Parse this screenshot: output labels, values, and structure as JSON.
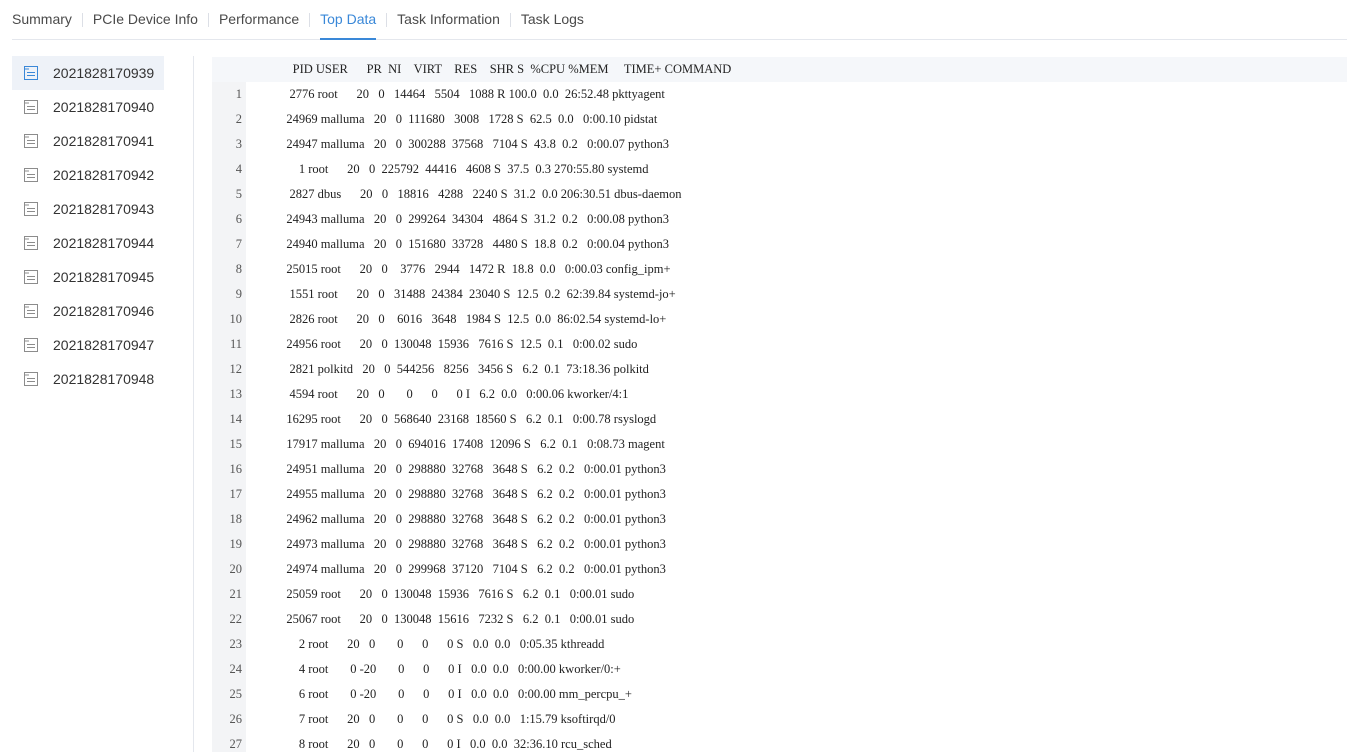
{
  "tabs": [
    {
      "label": "Summary",
      "active": false
    },
    {
      "label": "PCIe Device Info",
      "active": false
    },
    {
      "label": "Performance",
      "active": false
    },
    {
      "label": "Top Data",
      "active": true
    },
    {
      "label": "Task Information",
      "active": false
    },
    {
      "label": "Task Logs",
      "active": false
    }
  ],
  "sidebar": {
    "items": [
      {
        "label": "2021828170939",
        "active": true
      },
      {
        "label": "2021828170940",
        "active": false
      },
      {
        "label": "2021828170941",
        "active": false
      },
      {
        "label": "2021828170942",
        "active": false
      },
      {
        "label": "2021828170943",
        "active": false
      },
      {
        "label": "2021828170944",
        "active": false
      },
      {
        "label": "2021828170945",
        "active": false
      },
      {
        "label": "2021828170946",
        "active": false
      },
      {
        "label": "2021828170947",
        "active": false
      },
      {
        "label": "2021828170948",
        "active": false
      }
    ],
    "icon": "document-icon"
  },
  "top": {
    "header": "     PID USER      PR  NI    VIRT    RES    SHR S  %CPU %MEM     TIME+ COMMAND",
    "rows": [
      {
        "n": "1",
        "text": "    2776 root      20   0   14464   5504   1088 R 100.0  0.0  26:52.48 pkttyagent"
      },
      {
        "n": "2",
        "text": "   24969 malluma   20   0  111680   3008   1728 S  62.5  0.0   0:00.10 pidstat"
      },
      {
        "n": "3",
        "text": "   24947 malluma   20   0  300288  37568   7104 S  43.8  0.2   0:00.07 python3"
      },
      {
        "n": "4",
        "text": "       1 root      20   0  225792  44416   4608 S  37.5  0.3 270:55.80 systemd"
      },
      {
        "n": "5",
        "text": "    2827 dbus      20   0   18816   4288   2240 S  31.2  0.0 206:30.51 dbus-daemon"
      },
      {
        "n": "6",
        "text": "   24943 malluma   20   0  299264  34304   4864 S  31.2  0.2   0:00.08 python3"
      },
      {
        "n": "7",
        "text": "   24940 malluma   20   0  151680  33728   4480 S  18.8  0.2   0:00.04 python3"
      },
      {
        "n": "8",
        "text": "   25015 root      20   0    3776   2944   1472 R  18.8  0.0   0:00.03 config_ipm+"
      },
      {
        "n": "9",
        "text": "    1551 root      20   0   31488  24384  23040 S  12.5  0.2  62:39.84 systemd-jo+"
      },
      {
        "n": "10",
        "text": "    2826 root      20   0    6016   3648   1984 S  12.5  0.0  86:02.54 systemd-lo+"
      },
      {
        "n": "11",
        "text": "   24956 root      20   0  130048  15936   7616 S  12.5  0.1   0:00.02 sudo"
      },
      {
        "n": "12",
        "text": "    2821 polkitd   20   0  544256   8256   3456 S   6.2  0.1  73:18.36 polkitd"
      },
      {
        "n": "13",
        "text": "    4594 root      20   0       0      0      0 I   6.2  0.0   0:00.06 kworker/4:1"
      },
      {
        "n": "14",
        "text": "   16295 root      20   0  568640  23168  18560 S   6.2  0.1   0:00.78 rsyslogd"
      },
      {
        "n": "15",
        "text": "   17917 malluma   20   0  694016  17408  12096 S   6.2  0.1   0:08.73 magent"
      },
      {
        "n": "16",
        "text": "   24951 malluma   20   0  298880  32768   3648 S   6.2  0.2   0:00.01 python3"
      },
      {
        "n": "17",
        "text": "   24955 malluma   20   0  298880  32768   3648 S   6.2  0.2   0:00.01 python3"
      },
      {
        "n": "18",
        "text": "   24962 malluma   20   0  298880  32768   3648 S   6.2  0.2   0:00.01 python3"
      },
      {
        "n": "19",
        "text": "   24973 malluma   20   0  298880  32768   3648 S   6.2  0.2   0:00.01 python3"
      },
      {
        "n": "20",
        "text": "   24974 malluma   20   0  299968  37120   7104 S   6.2  0.2   0:00.01 python3"
      },
      {
        "n": "21",
        "text": "   25059 root      20   0  130048  15936   7616 S   6.2  0.1   0:00.01 sudo"
      },
      {
        "n": "22",
        "text": "   25067 root      20   0  130048  15616   7232 S   6.2  0.1   0:00.01 sudo"
      },
      {
        "n": "23",
        "text": "       2 root      20   0       0      0      0 S   0.0  0.0   0:05.35 kthreadd"
      },
      {
        "n": "24",
        "text": "       4 root       0 -20       0      0      0 I   0.0  0.0   0:00.00 kworker/0:+"
      },
      {
        "n": "25",
        "text": "       6 root       0 -20       0      0      0 I   0.0  0.0   0:00.00 mm_percpu_+"
      },
      {
        "n": "26",
        "text": "       7 root      20   0       0      0      0 S   0.0  0.0   1:15.79 ksoftirqd/0"
      },
      {
        "n": "27",
        "text": "       8 root      20   0       0      0      0 I   0.0  0.0  32:36.10 rcu_sched"
      }
    ]
  },
  "colors": {
    "accent": "#3a88d8",
    "active_bg": "#eef2f8",
    "gutter": "#f3f4f6"
  }
}
